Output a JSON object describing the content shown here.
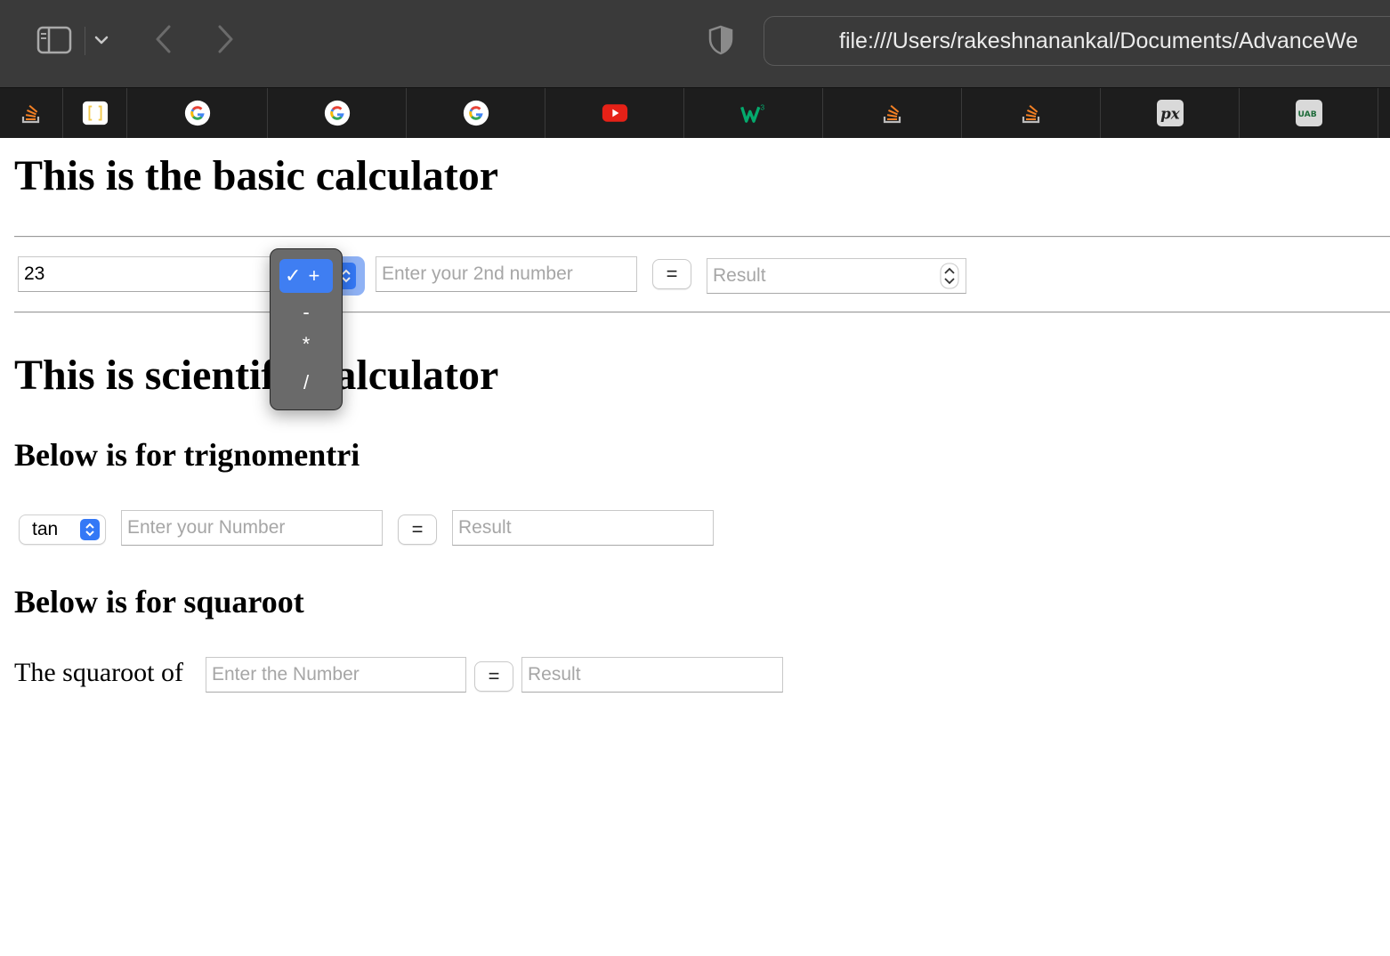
{
  "browser": {
    "url": "file:///Users/rakeshnanankal/Documents/AdvanceWe",
    "favorites": [
      {
        "icon": "stackoverflow-icon"
      },
      {
        "icon": "brackets-icon"
      },
      {
        "icon": "google-icon"
      },
      {
        "icon": "google-icon"
      },
      {
        "icon": "google-icon"
      },
      {
        "icon": "youtube-icon"
      },
      {
        "icon": "w3schools-icon"
      },
      {
        "icon": "stackoverflow-icon"
      },
      {
        "icon": "stackoverflow-icon"
      },
      {
        "icon": "px-icon"
      },
      {
        "icon": "uab-icon"
      }
    ]
  },
  "basic": {
    "title": "This is the basic calculator",
    "num1_value": "23",
    "num2_placeholder": "Enter your 2nd number",
    "equals_label": "=",
    "result_placeholder": "Result",
    "operator_options": [
      "+",
      "-",
      "*",
      "/"
    ],
    "operator_selected": "+",
    "check_mark": "✓"
  },
  "scientific": {
    "title_left": "This is scientif",
    "title_right": "alculator"
  },
  "trig": {
    "heading": "Below is for trignomentri",
    "function_selected": "tan",
    "number_placeholder": "Enter your Number",
    "equals_label": "=",
    "result_placeholder": "Result"
  },
  "sqrt": {
    "heading": "Below is for squaroot",
    "label": "The squaroot of",
    "number_placeholder": "Enter the Number",
    "equals_label": "=",
    "result_placeholder": "Result"
  },
  "colors": {
    "accent": "#3478f6",
    "toolbar": "#3a3a3a",
    "favbar": "#1d1d1d",
    "popup": "#6a6a6a"
  }
}
